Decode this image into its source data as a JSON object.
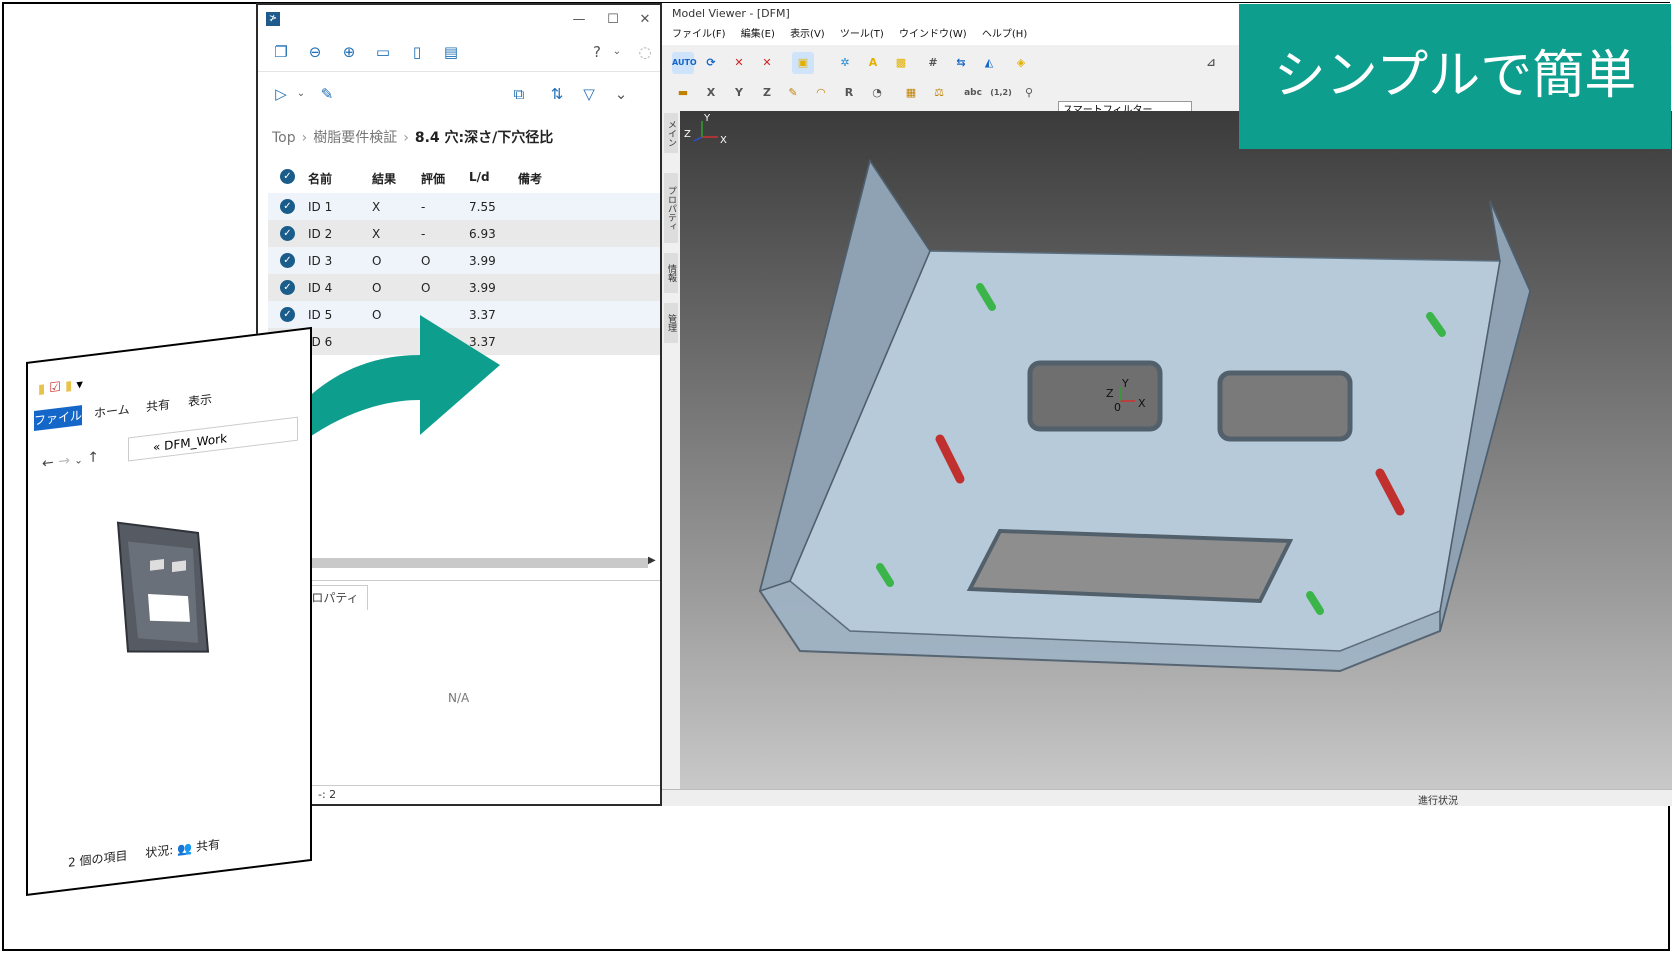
{
  "panel": {
    "breadcrumb": [
      "Top",
      "樹脂要件検証",
      "8.4 穴:深さ/下穴径比"
    ],
    "columns": [
      "名前",
      "結果",
      "評価",
      "L/d",
      "備考"
    ],
    "rows": [
      {
        "name": "ID 1",
        "result": "X",
        "eval": "-",
        "ld": "7.55"
      },
      {
        "name": "ID 2",
        "result": "X",
        "eval": "-",
        "ld": "6.93"
      },
      {
        "name": "ID 3",
        "result": "O",
        "eval": "O",
        "ld": "3.99"
      },
      {
        "name": "ID 4",
        "result": "O",
        "eval": "O",
        "ld": "3.99"
      },
      {
        "name": "ID 5",
        "result": "O",
        "eval": "",
        "ld": "3.37"
      },
      {
        "name": "ID 6",
        "result": "",
        "eval": "",
        "ld": "3.37"
      }
    ],
    "property_tab": "ロパティ",
    "na": "N/A",
    "count": "-: 2",
    "help": "?"
  },
  "viewer": {
    "title": "Model Viewer - [DFM]",
    "menu": [
      "ファイル(F)",
      "編集(E)",
      "表示(V)",
      "ツール(T)",
      "ウインドウ(W)",
      "ヘルプ(H)"
    ],
    "filter": "スマートフィルター",
    "side_tabs": [
      "メイン",
      "プロパティ",
      "情報",
      "管理"
    ],
    "status": "進行状況",
    "axis_triad": {
      "x": "X",
      "y": "Y",
      "z": "Z",
      "origin": "0"
    },
    "tool_labels": [
      "AUTO",
      "abc",
      "(1,2)",
      "X",
      "Y",
      "Z",
      "R"
    ]
  },
  "banner": {
    "text": "シンプルで簡単"
  },
  "explorer": {
    "file_tab": "ファイル",
    "tabs": [
      "ホーム",
      "共有",
      "表示"
    ],
    "path": "« DFM_Work",
    "status_count": "2 個の項目",
    "status_state": "状況:",
    "status_shared": "共有"
  },
  "colors": {
    "accent": "#0e9e8e",
    "check": "#1a5c8a",
    "pass": "#3bb54a",
    "fail": "#c0302f"
  }
}
